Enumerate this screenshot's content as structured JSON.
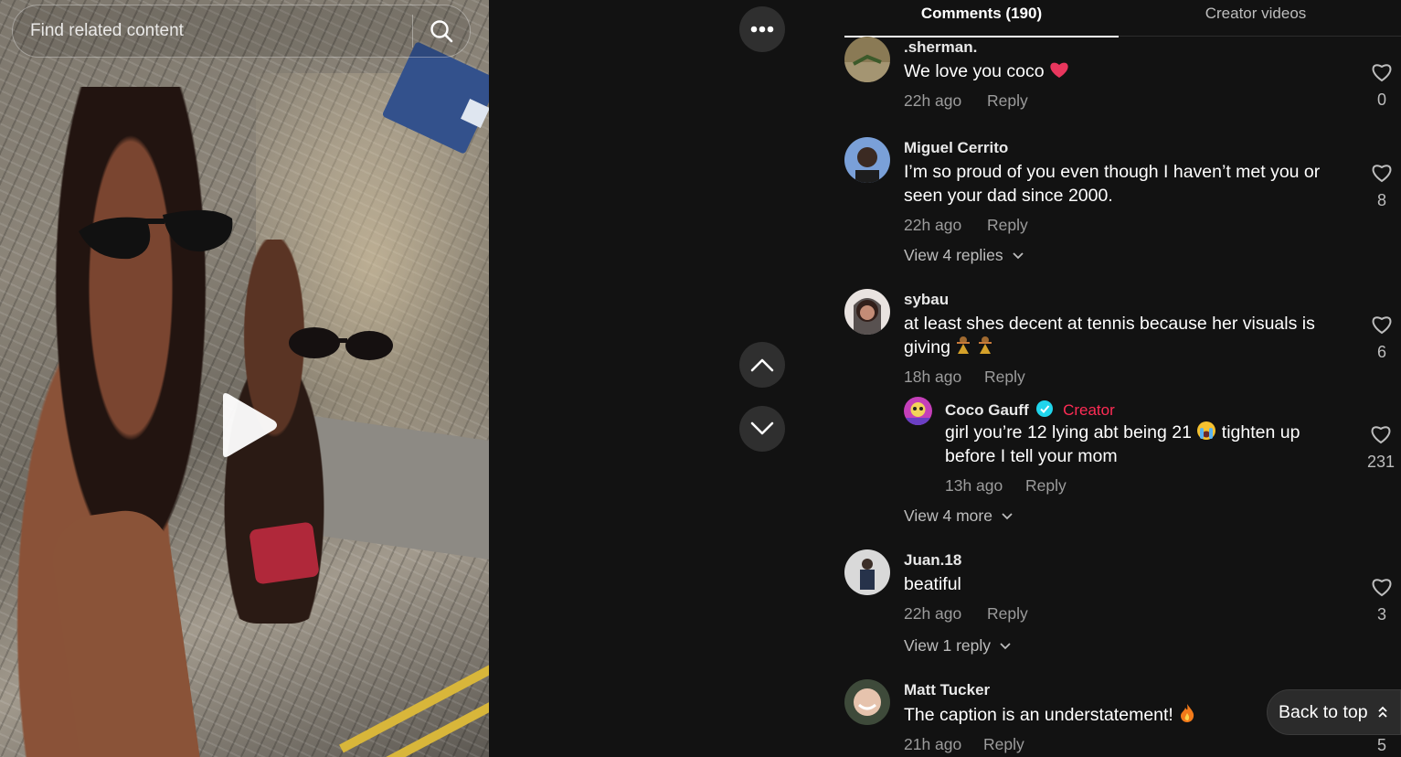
{
  "search": {
    "placeholder": "Find related content"
  },
  "icons": {
    "search": "search-icon",
    "play": "play-icon",
    "more": "more-horizontal-icon",
    "up": "chevron-up-icon",
    "down": "chevron-down-icon",
    "like": "heart-outline-icon",
    "back_to_top": "double-chevron-up-icon"
  },
  "tabs": [
    {
      "label": "Comments (190)",
      "active": true
    },
    {
      "label": "Creator videos",
      "active": false
    }
  ],
  "reply_label": "Reply",
  "comments": [
    {
      "user": ".sherman.",
      "text": "We love you coco",
      "emoji": "pink-heart",
      "time": "22h ago",
      "likes": "0"
    },
    {
      "user": "Miguel Cerrito",
      "text": "I’m so proud of you even though I haven’t met you or seen your dad since 2000.",
      "time": "22h ago",
      "likes": "8",
      "view_more": "View 4 replies"
    },
    {
      "user": "sybau",
      "text": "at least shes decent at tennis because her visuals is giving",
      "emoji": "people-dancing",
      "time": "18h ago",
      "likes": "6",
      "reply": {
        "user": "Coco Gauff",
        "tag": "Creator",
        "text_a": "girl you’re 12 lying abt being 21",
        "text_b": "tighten up before I tell your mom",
        "emoji": "loudly-crying-face",
        "time": "13h ago",
        "likes": "231"
      },
      "view_more": "View 4 more"
    },
    {
      "user": "Juan.18",
      "text": "beatiful",
      "time": "22h ago",
      "likes": "3",
      "view_more": "View 1 reply"
    },
    {
      "user": "Matt Tucker",
      "text": "The caption is an understatement!",
      "emoji": "fire",
      "time": "21h ago",
      "likes": "5"
    }
  ],
  "back_to_top": {
    "label": "Back to top"
  },
  "colors": {
    "background": "#121212",
    "creator_red": "#fe2c55",
    "verified_cyan": "#20d5ec",
    "heart_pink": "#e8365d"
  }
}
